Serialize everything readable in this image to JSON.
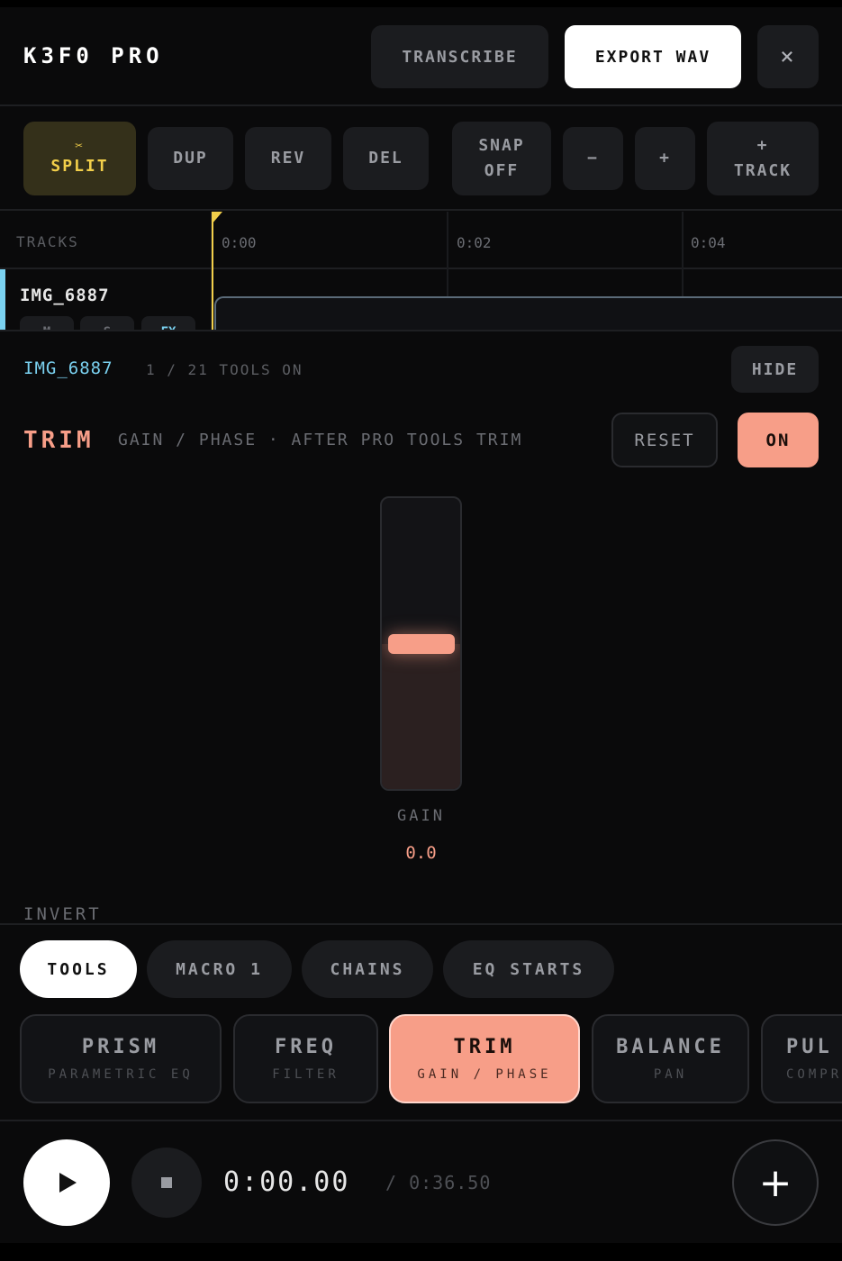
{
  "header": {
    "logo": "K3F0 PRO",
    "transcribe_label": "TRANSCRIBE",
    "export_label": "EXPORT WAV",
    "close_label": "×"
  },
  "toolbar": {
    "split_icon": "✂",
    "split_label": "SPLIT",
    "dup_label": "DUP",
    "rev_label": "REV",
    "del_label": "DEL",
    "snap_line1": "SNAP",
    "snap_line2": "OFF",
    "zoom_out_label": "−",
    "zoom_in_label": "+",
    "track_line1": "+",
    "track_line2": "TRACK"
  },
  "timeline": {
    "tracks_label": "TRACKS",
    "ticks": [
      "0:00",
      "0:02",
      "0:04"
    ],
    "track": {
      "name": "IMG_6887",
      "buttons": [
        "M",
        "S",
        "FX"
      ],
      "accent_color": "#7ad1f0"
    }
  },
  "panel": {
    "track_name": "IMG_6887",
    "tools_count": "1 / 21 TOOLS ON",
    "hide_label": "HIDE",
    "plugin_title": "TRIM",
    "plugin_subtitle": "GAIN / PHASE · AFTER PRO TOOLS TRIM",
    "reset_label": "RESET",
    "on_label": "ON",
    "fader_label": "GAIN",
    "fader_value": "0.0",
    "fader_level": 0.5,
    "invert_label": "INVERT",
    "accent_color": "#f79e88"
  },
  "tabs": [
    {
      "label": "TOOLS",
      "active": true
    },
    {
      "label": "MACRO 1",
      "active": false
    },
    {
      "label": "CHAINS",
      "active": false
    },
    {
      "label": "EQ STARTS",
      "active": false
    }
  ],
  "tools": [
    {
      "name": "PRISM",
      "desc": "PARAMETRIC EQ",
      "active": false
    },
    {
      "name": "FREQ",
      "desc": "FILTER",
      "active": false
    },
    {
      "name": "TRIM",
      "desc": "GAIN / PHASE",
      "active": true
    },
    {
      "name": "BALANCE",
      "desc": "PAN",
      "active": false
    },
    {
      "name": "PUL",
      "desc": "COMPR",
      "active": false
    }
  ],
  "transport": {
    "current_time": "0:00.00",
    "total_time": "/ 0:36.50",
    "add_label": "+"
  }
}
